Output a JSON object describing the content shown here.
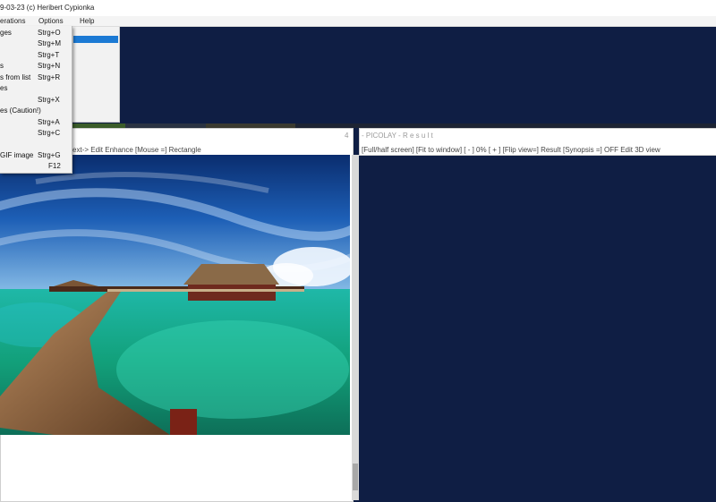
{
  "title_bar": {
    "text": "9-03-23  (c) Heribert Cypionka"
  },
  "menu_bar": {
    "operations": "erations",
    "options": "Options",
    "help": "Help"
  },
  "file_menu": {
    "items": [
      {
        "label": "ges",
        "shortcut": "Strg+O"
      },
      {
        "label": "",
        "shortcut": "Strg+M"
      },
      {
        "label": "",
        "shortcut": "Strg+T"
      },
      {
        "label": "s",
        "shortcut": "Strg+N"
      },
      {
        "label": "s from list",
        "shortcut": "Strg+R"
      },
      {
        "label": "es",
        "shortcut": ""
      },
      {
        "label": "",
        "shortcut": "Strg+X"
      },
      {
        "label": "es (Caution!)",
        "shortcut": ""
      },
      {
        "label": "",
        "shortcut": "Strg+A"
      },
      {
        "label": "",
        "shortcut": "Strg+C"
      },
      {
        "label": "",
        "shortcut": ""
      },
      {
        "label": "GIF image",
        "shortcut": "Strg+G"
      },
      {
        "label": "",
        "shortcut": "F12"
      }
    ]
  },
  "left_window": {
    "title": "4",
    "toolbar": "ext->   Edit   Enhance   [Mouse =] Rectangle"
  },
  "right_window": {
    "title": "- PICOLAY  -  R e s u l t",
    "toolbar": "[Full/half screen]   [Fit to window]   [ - ]   0%   [ + ]   [Flip view=] Result   [Synopsis =] OFF   Edit   3D view"
  },
  "colors": {
    "desktop": "#0f1e44",
    "highlight": "#1c7ad4"
  },
  "icons": [
    "bungalow-photo"
  ]
}
